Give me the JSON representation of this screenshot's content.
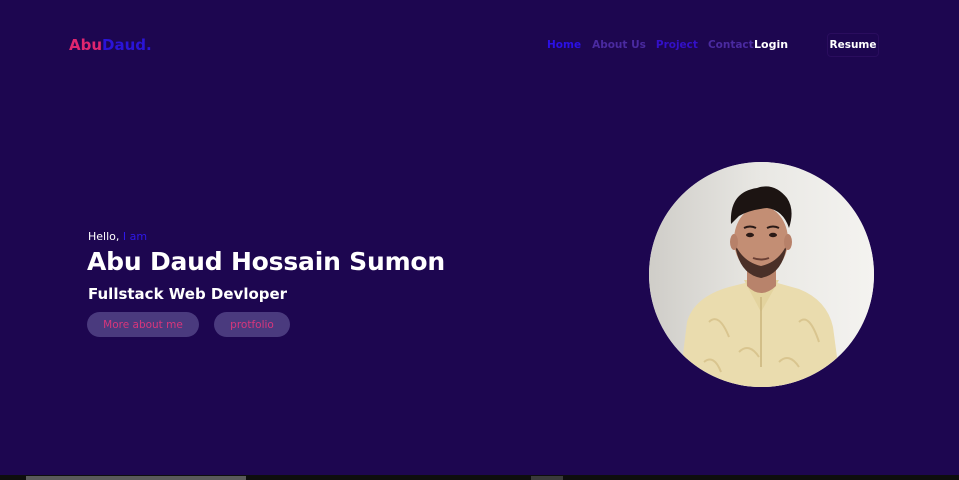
{
  "header": {
    "logo_part1": "Abu",
    "logo_part2": "Daud.",
    "nav": {
      "home": "Home",
      "about": "About Us",
      "project": "Project",
      "contact": "Contact"
    },
    "login_label": "Login",
    "resume_label": "Resume"
  },
  "hero": {
    "greeting": "Hello,",
    "greeting_highlight": "I am",
    "name": "Abu Daud Hossain Sumon",
    "role": "Fullstack Web Devloper",
    "more_button": "More about me",
    "portfolio_button": "protfolio"
  },
  "colors": {
    "background": "#1d0650",
    "accent_pink": "#e0266f",
    "accent_blue": "#2a14d8",
    "button_bg": "#4a3a7e"
  },
  "icons": {
    "profile": "profile-photo"
  }
}
